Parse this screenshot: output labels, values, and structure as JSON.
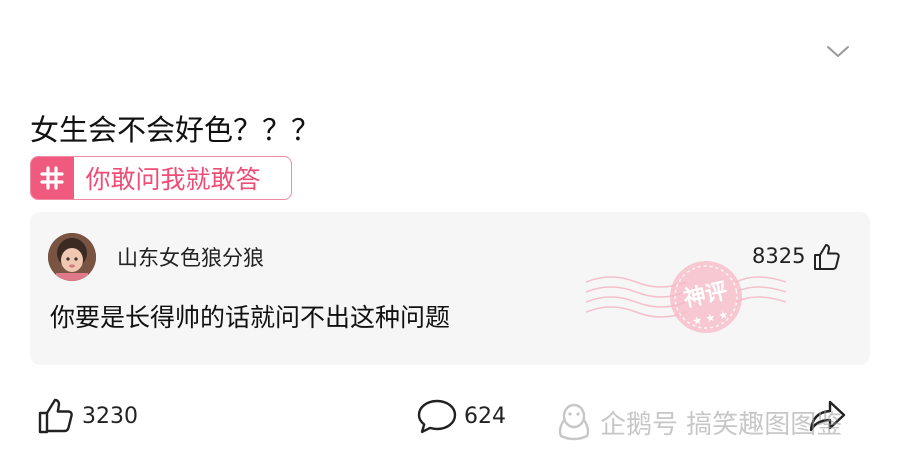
{
  "post": {
    "title": "女生会不会好色？？？",
    "topic_label": "你敢问我就敢答"
  },
  "comment": {
    "username": "山东女色狼分狼",
    "like_count": "8325",
    "text": "你要是长得帅的话就问不出这种问题",
    "stamp_text": "神评"
  },
  "actions": {
    "like_count": "3230",
    "comment_count": "624"
  },
  "watermark": {
    "text": "企鹅号 搞笑趣图图鉴"
  },
  "colors": {
    "accent": "#f05a7e",
    "card_bg": "#f6f6f6",
    "stamp": "#f4a3b5"
  },
  "icons": [
    "chevron-down-icon",
    "hash-icon",
    "thumbs-up-icon",
    "comment-icon",
    "share-icon",
    "penguin-icon"
  ]
}
